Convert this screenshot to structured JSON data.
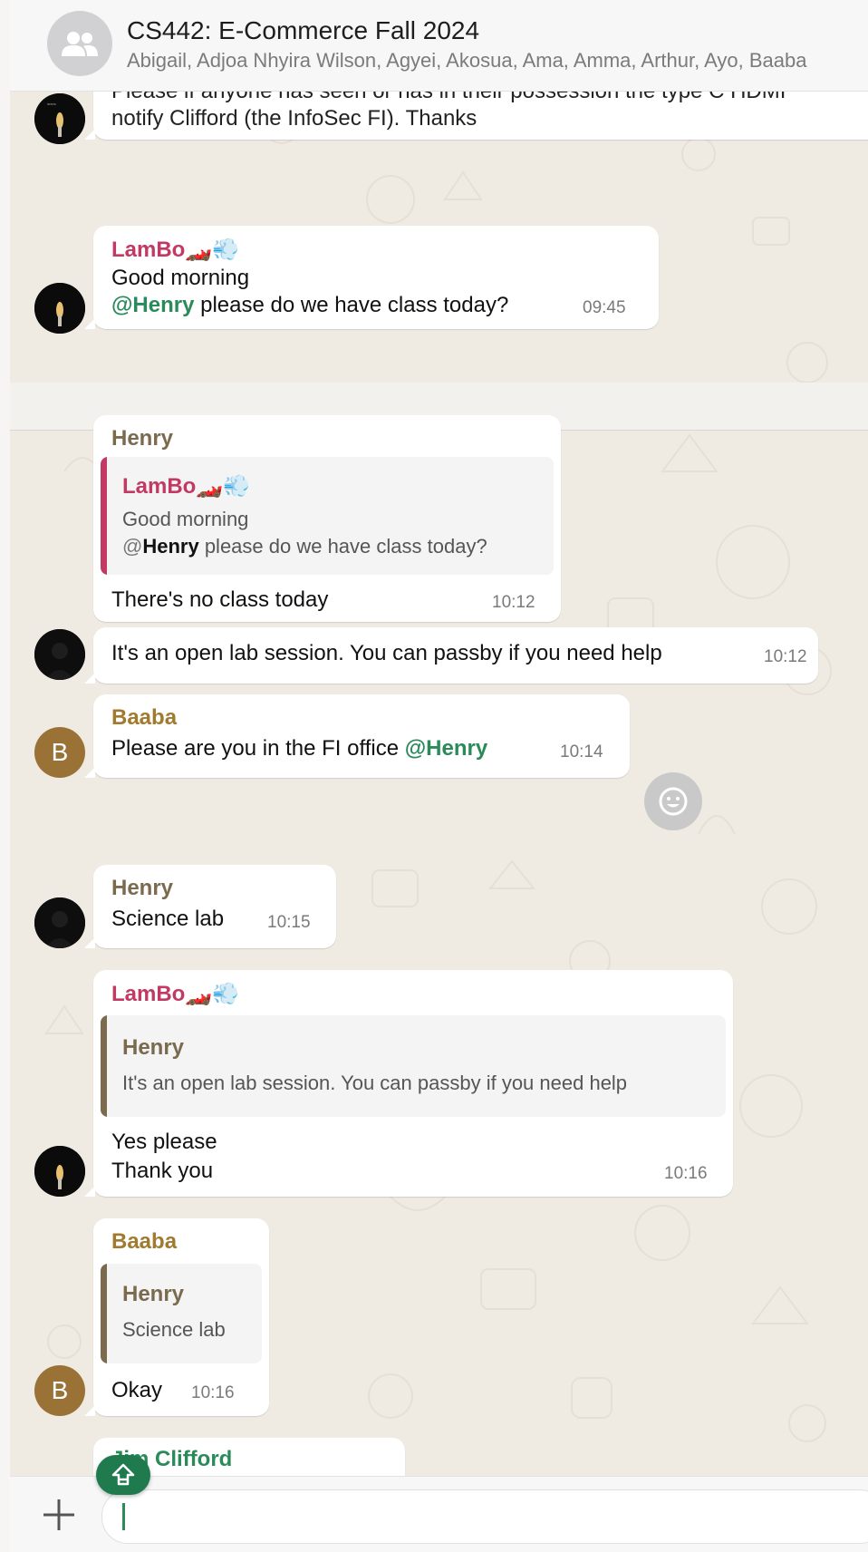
{
  "header": {
    "title": "CS442: E-Commerce Fall 2024",
    "members": "Abigail, Adjoa Nhyira Wilson, Agyei, Akosua, Ama, Amma, Arthur, Ayo, Baaba"
  },
  "colors": {
    "lambo": "#c23a64",
    "henry": "#7b6a4e",
    "baaba": "#a07a2e",
    "clifford": "#2a8a5a",
    "chat_bg": "#efeae2"
  },
  "messages": {
    "m0": {
      "line1": "Please if anyone has seen or has in their possession the type C HDMI",
      "line2": "notify Clifford (the InfoSec FI). Thanks"
    },
    "m1": {
      "sender": "LamBo🏎️💨",
      "line1": "Good morning",
      "mention": "Henry",
      "line2_rest": " please do we have class today?",
      "time": "09:45"
    },
    "m2": {
      "sender": "Henry",
      "quote_sender": "LamBo🏎️💨",
      "quote_line1": "Good morning",
      "quote_mention": "Henry",
      "quote_line2_rest": " please do we have class today?",
      "text": "There's no class today",
      "time": "10:12"
    },
    "m3": {
      "text": "It's an open lab session. You can passby if you need help",
      "time": "10:12"
    },
    "m4": {
      "sender": "Baaba",
      "text": "Please are you in the FI office ",
      "mention": "@Henry",
      "time": "10:14"
    },
    "m5": {
      "sender": "Henry",
      "text": "Science lab",
      "time": "10:15"
    },
    "m6": {
      "sender": "LamBo🏎️💨",
      "quote_sender": "Henry",
      "quote_text": "It's an open lab session. You can passby if you need help",
      "line1": "Yes please",
      "line2": "Thank you",
      "time": "10:16"
    },
    "m7": {
      "sender": "Baaba",
      "quote_sender": "Henry",
      "quote_text": "Science lab",
      "text": "Okay",
      "time": "10:16"
    },
    "m8": {
      "sender": "Jim Clifford"
    }
  },
  "avatars": {
    "baaba_initial": "B"
  },
  "icons": {
    "group": "group-icon",
    "emoji": "emoji-icon",
    "scroll": "scroll-to-mention-icon",
    "plus": "plus-icon"
  }
}
